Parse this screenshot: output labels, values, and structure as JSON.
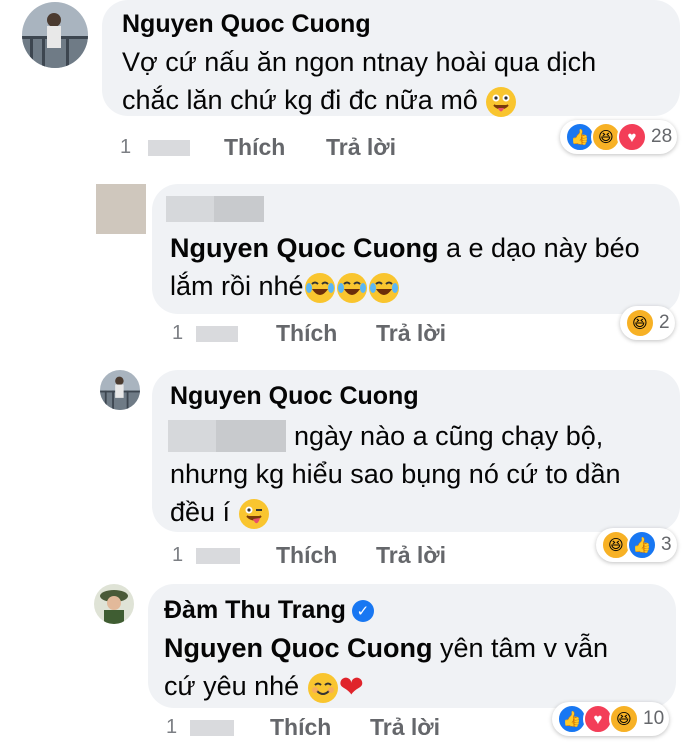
{
  "comments": [
    {
      "author": "Nguyen Quoc Cuong",
      "line1": "Vợ cứ nấu ăn ngon ntnay hoài qua dịch",
      "line2": "chắc lăn chứ kg đi đc nữa mô",
      "time": "1",
      "like_label": "Thích",
      "reply_label": "Trả lời",
      "reaction_count": "28",
      "reactions": [
        "like",
        "haha",
        "love"
      ]
    },
    {
      "author_hidden": true,
      "mention": "Nguyen Quoc Cuong",
      "line1_rest": " a e dạo này béo",
      "line2": "lắm rồi nhé",
      "time": "1",
      "like_label": "Thích",
      "reply_label": "Trả lời",
      "reaction_count": "2",
      "reactions": [
        "haha"
      ]
    },
    {
      "author": "Nguyen Quoc Cuong",
      "line1_rest": "ngày nào a cũng chạy bộ,",
      "line2": "nhưng kg hiểu sao bụng nó cứ to dần",
      "line3": "đều í",
      "time": "1",
      "like_label": "Thích",
      "reply_label": "Trả lời",
      "reaction_count": "3",
      "reactions": [
        "haha",
        "like"
      ]
    },
    {
      "author": "Đàm Thu Trang",
      "verified": true,
      "mention": "Nguyen Quoc Cuong",
      "line1_rest": " yên tâm v vẫn",
      "line2": "cứ yêu nhé",
      "time": "1",
      "like_label": "Thích",
      "reply_label": "Trả lời",
      "reaction_count": "10",
      "reactions": [
        "like",
        "love",
        "haha"
      ]
    }
  ],
  "icons": {
    "like": "thumbs-up-icon",
    "haha": "laughing-face-icon",
    "love": "heart-icon",
    "verified": "verified-check-icon"
  },
  "colors": {
    "bubble": "#f0f2f5",
    "like": "#1877f2",
    "love": "#f33e58",
    "haha": "#f7b125",
    "secondary_text": "#65676b"
  }
}
